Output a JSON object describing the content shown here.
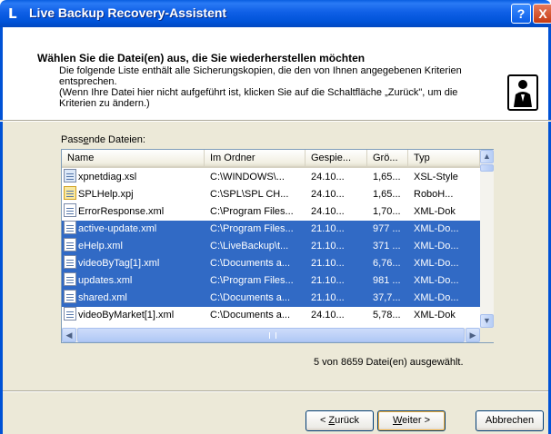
{
  "window": {
    "title": "Live Backup Recovery-Assistent",
    "app_icon": "L",
    "help_label": "?",
    "close_label": "X"
  },
  "header": {
    "title": "Wählen Sie die Datei(en) aus, die Sie wiederherstellen möchten",
    "desc_line1": "Die folgende Liste enthält alle Sicherungskopien, die den von Ihnen angegebenen Kriterien entsprechen.",
    "desc_line2": "(Wenn Ihre Datei hier nicht aufgeführt ist, klicken Sie auf die Schaltfläche „Zurück\", um die Kriterien zu ändern.)"
  },
  "list": {
    "label_prefix": "Pass",
    "label_accel": "e",
    "label_suffix": "nde Dateien:",
    "columns": [
      "Name",
      "Im Ordner",
      "Gespie...",
      "Grö...",
      "Typ"
    ],
    "rows": [
      {
        "name": "xpnetdiag.xsl",
        "folder": "C:\\WINDOWS\\...",
        "saved": "24.10...",
        "size": "1,65...",
        "type": "XSL-Style",
        "icon": "xsl-file-icon",
        "selected": false
      },
      {
        "name": "SPLHelp.xpj",
        "folder": "C:\\SPL\\SPL CH...",
        "saved": "24.10...",
        "size": "1,65...",
        "type": "RoboH...",
        "icon": "xpj-file-icon",
        "selected": false
      },
      {
        "name": "ErrorResponse.xml",
        "folder": "C:\\Program Files...",
        "saved": "24.10...",
        "size": "1,70...",
        "type": "XML-Dok",
        "icon": "xml-file-icon",
        "selected": false
      },
      {
        "name": "active-update.xml",
        "folder": "C:\\Program Files...",
        "saved": "21.10...",
        "size": "977 ...",
        "type": "XML-Do...",
        "icon": "xml-file-icon",
        "selected": true
      },
      {
        "name": "eHelp.xml",
        "folder": "C:\\LiveBackup\\t...",
        "saved": "21.10...",
        "size": "371 ...",
        "type": "XML-Do...",
        "icon": "xml-file-icon",
        "selected": true
      },
      {
        "name": "videoByTag[1].xml",
        "folder": "C:\\Documents a...",
        "saved": "21.10...",
        "size": "6,76...",
        "type": "XML-Do...",
        "icon": "xml-file-icon",
        "selected": true
      },
      {
        "name": "updates.xml",
        "folder": "C:\\Program Files...",
        "saved": "21.10...",
        "size": "981 ...",
        "type": "XML-Do...",
        "icon": "xml-file-icon",
        "selected": true
      },
      {
        "name": "shared.xml",
        "folder": "C:\\Documents a...",
        "saved": "21.10...",
        "size": "37,7...",
        "type": "XML-Do...",
        "icon": "xml-file-icon",
        "selected": true
      },
      {
        "name": "videoByMarket[1].xml",
        "folder": "C:\\Documents a...",
        "saved": "24.10...",
        "size": "5,78...",
        "type": "XML-Dok",
        "icon": "xml-file-icon",
        "selected": false
      }
    ]
  },
  "status": "5 von 8659 Datei(en) ausgewählt.",
  "buttons": {
    "back_prefix": "< ",
    "back_accel": "Z",
    "back_suffix": "urück",
    "next_accel": "W",
    "next_suffix": "eiter >",
    "cancel": "Abbrechen"
  }
}
